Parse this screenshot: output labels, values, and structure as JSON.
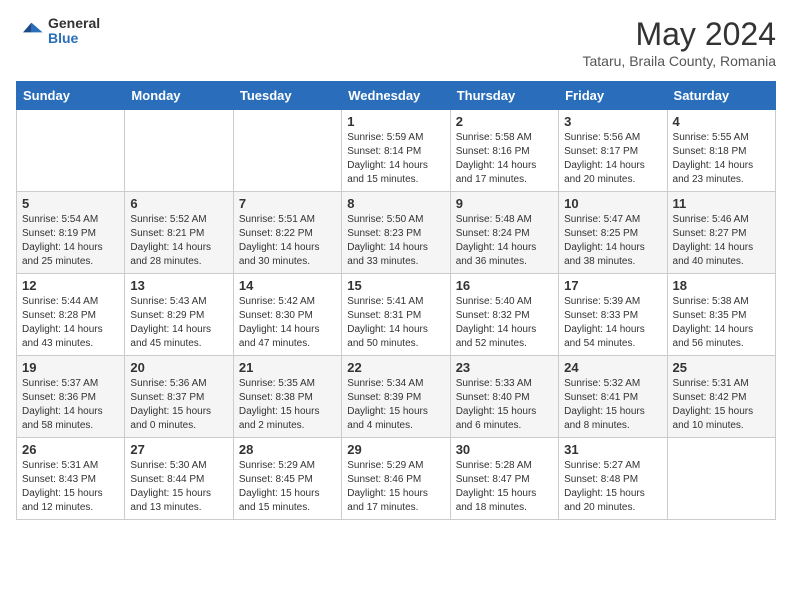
{
  "header": {
    "logo_general": "General",
    "logo_blue": "Blue",
    "month_year": "May 2024",
    "location": "Tataru, Braila County, Romania"
  },
  "days_of_week": [
    "Sunday",
    "Monday",
    "Tuesday",
    "Wednesday",
    "Thursday",
    "Friday",
    "Saturday"
  ],
  "weeks": [
    [
      {
        "day": "",
        "info": ""
      },
      {
        "day": "",
        "info": ""
      },
      {
        "day": "",
        "info": ""
      },
      {
        "day": "1",
        "info": "Sunrise: 5:59 AM\nSunset: 8:14 PM\nDaylight: 14 hours\nand 15 minutes."
      },
      {
        "day": "2",
        "info": "Sunrise: 5:58 AM\nSunset: 8:16 PM\nDaylight: 14 hours\nand 17 minutes."
      },
      {
        "day": "3",
        "info": "Sunrise: 5:56 AM\nSunset: 8:17 PM\nDaylight: 14 hours\nand 20 minutes."
      },
      {
        "day": "4",
        "info": "Sunrise: 5:55 AM\nSunset: 8:18 PM\nDaylight: 14 hours\nand 23 minutes."
      }
    ],
    [
      {
        "day": "5",
        "info": "Sunrise: 5:54 AM\nSunset: 8:19 PM\nDaylight: 14 hours\nand 25 minutes."
      },
      {
        "day": "6",
        "info": "Sunrise: 5:52 AM\nSunset: 8:21 PM\nDaylight: 14 hours\nand 28 minutes."
      },
      {
        "day": "7",
        "info": "Sunrise: 5:51 AM\nSunset: 8:22 PM\nDaylight: 14 hours\nand 30 minutes."
      },
      {
        "day": "8",
        "info": "Sunrise: 5:50 AM\nSunset: 8:23 PM\nDaylight: 14 hours\nand 33 minutes."
      },
      {
        "day": "9",
        "info": "Sunrise: 5:48 AM\nSunset: 8:24 PM\nDaylight: 14 hours\nand 36 minutes."
      },
      {
        "day": "10",
        "info": "Sunrise: 5:47 AM\nSunset: 8:25 PM\nDaylight: 14 hours\nand 38 minutes."
      },
      {
        "day": "11",
        "info": "Sunrise: 5:46 AM\nSunset: 8:27 PM\nDaylight: 14 hours\nand 40 minutes."
      }
    ],
    [
      {
        "day": "12",
        "info": "Sunrise: 5:44 AM\nSunset: 8:28 PM\nDaylight: 14 hours\nand 43 minutes."
      },
      {
        "day": "13",
        "info": "Sunrise: 5:43 AM\nSunset: 8:29 PM\nDaylight: 14 hours\nand 45 minutes."
      },
      {
        "day": "14",
        "info": "Sunrise: 5:42 AM\nSunset: 8:30 PM\nDaylight: 14 hours\nand 47 minutes."
      },
      {
        "day": "15",
        "info": "Sunrise: 5:41 AM\nSunset: 8:31 PM\nDaylight: 14 hours\nand 50 minutes."
      },
      {
        "day": "16",
        "info": "Sunrise: 5:40 AM\nSunset: 8:32 PM\nDaylight: 14 hours\nand 52 minutes."
      },
      {
        "day": "17",
        "info": "Sunrise: 5:39 AM\nSunset: 8:33 PM\nDaylight: 14 hours\nand 54 minutes."
      },
      {
        "day": "18",
        "info": "Sunrise: 5:38 AM\nSunset: 8:35 PM\nDaylight: 14 hours\nand 56 minutes."
      }
    ],
    [
      {
        "day": "19",
        "info": "Sunrise: 5:37 AM\nSunset: 8:36 PM\nDaylight: 14 hours\nand 58 minutes."
      },
      {
        "day": "20",
        "info": "Sunrise: 5:36 AM\nSunset: 8:37 PM\nDaylight: 15 hours\nand 0 minutes."
      },
      {
        "day": "21",
        "info": "Sunrise: 5:35 AM\nSunset: 8:38 PM\nDaylight: 15 hours\nand 2 minutes."
      },
      {
        "day": "22",
        "info": "Sunrise: 5:34 AM\nSunset: 8:39 PM\nDaylight: 15 hours\nand 4 minutes."
      },
      {
        "day": "23",
        "info": "Sunrise: 5:33 AM\nSunset: 8:40 PM\nDaylight: 15 hours\nand 6 minutes."
      },
      {
        "day": "24",
        "info": "Sunrise: 5:32 AM\nSunset: 8:41 PM\nDaylight: 15 hours\nand 8 minutes."
      },
      {
        "day": "25",
        "info": "Sunrise: 5:31 AM\nSunset: 8:42 PM\nDaylight: 15 hours\nand 10 minutes."
      }
    ],
    [
      {
        "day": "26",
        "info": "Sunrise: 5:31 AM\nSunset: 8:43 PM\nDaylight: 15 hours\nand 12 minutes."
      },
      {
        "day": "27",
        "info": "Sunrise: 5:30 AM\nSunset: 8:44 PM\nDaylight: 15 hours\nand 13 minutes."
      },
      {
        "day": "28",
        "info": "Sunrise: 5:29 AM\nSunset: 8:45 PM\nDaylight: 15 hours\nand 15 minutes."
      },
      {
        "day": "29",
        "info": "Sunrise: 5:29 AM\nSunset: 8:46 PM\nDaylight: 15 hours\nand 17 minutes."
      },
      {
        "day": "30",
        "info": "Sunrise: 5:28 AM\nSunset: 8:47 PM\nDaylight: 15 hours\nand 18 minutes."
      },
      {
        "day": "31",
        "info": "Sunrise: 5:27 AM\nSunset: 8:48 PM\nDaylight: 15 hours\nand 20 minutes."
      },
      {
        "day": "",
        "info": ""
      }
    ]
  ]
}
